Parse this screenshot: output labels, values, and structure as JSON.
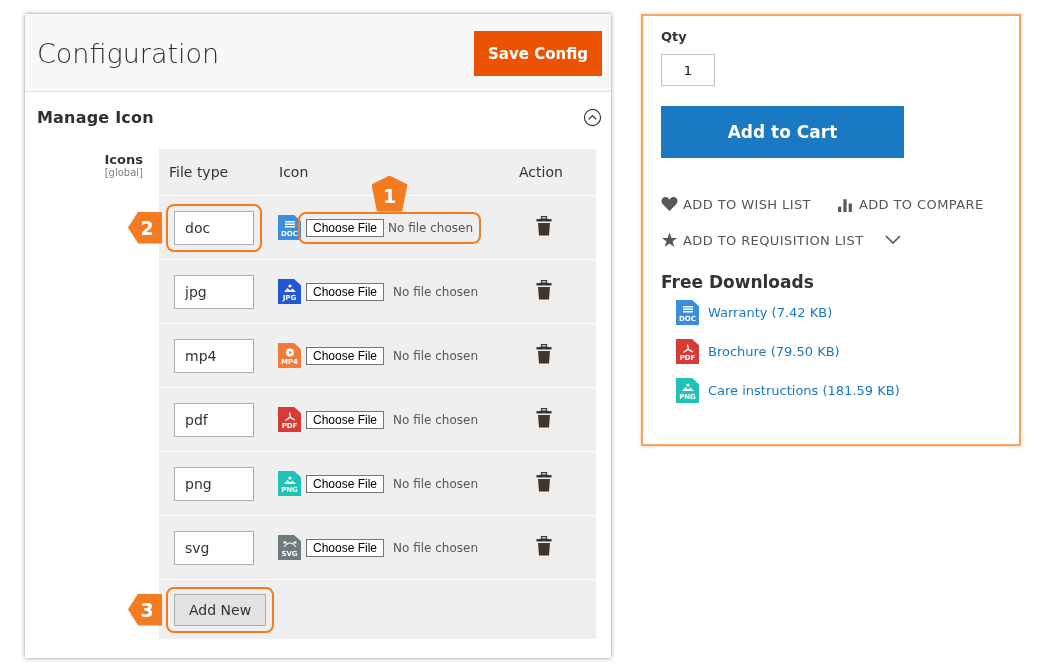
{
  "config": {
    "title": "Configuration",
    "save_button": "Save Config",
    "section": {
      "title": "Manage Icon",
      "expanded": true
    },
    "field_label": "Icons",
    "field_scope": "[global]",
    "columns": [
      "File type",
      "Icon",
      "Action"
    ],
    "rows": [
      {
        "file_type": "doc",
        "icon": {
          "kind": "doc",
          "label": "DOC",
          "color": "#3b8de0"
        },
        "choose": "Choose File",
        "status": "No file chosen",
        "type_callout": "2",
        "file_callout": "1"
      },
      {
        "file_type": "jpg",
        "icon": {
          "kind": "image",
          "label": "JPG",
          "color": "#2357d6"
        },
        "choose": "Choose File",
        "status": "No file chosen"
      },
      {
        "file_type": "mp4",
        "icon": {
          "kind": "play",
          "label": "MP4",
          "color": "#f47a3c"
        },
        "choose": "Choose File",
        "status": "No file chosen"
      },
      {
        "file_type": "pdf",
        "icon": {
          "kind": "pdf",
          "label": "PDF",
          "color": "#d83b35"
        },
        "choose": "Choose File",
        "status": "No file chosen"
      },
      {
        "file_type": "png",
        "icon": {
          "kind": "image",
          "label": "PNG",
          "color": "#1fc2b4"
        },
        "choose": "Choose File",
        "status": "No file chosen"
      },
      {
        "file_type": "svg",
        "icon": {
          "kind": "bezier",
          "label": "SVG",
          "color": "#6e7a7d"
        },
        "choose": "Choose File",
        "status": "No file chosen"
      }
    ],
    "add_button": "Add New",
    "add_callout": "3"
  },
  "product": {
    "qty_label": "Qty",
    "qty": "1",
    "add_to_cart": "Add to Cart",
    "actions": [
      {
        "kind": "heart",
        "label": "ADD TO WISH LIST"
      },
      {
        "kind": "chart",
        "label": "ADD TO COMPARE"
      },
      {
        "kind": "star",
        "label": "ADD TO REQUISITION LIST",
        "dropdown": true
      }
    ],
    "downloads_title": "Free Downloads",
    "downloads": [
      {
        "label": "Warranty (7.42 KB)",
        "icon": {
          "kind": "doc",
          "label": "DOC",
          "color": "#3b8de0"
        }
      },
      {
        "label": "Brochure (79.50 KB)",
        "icon": {
          "kind": "pdf",
          "label": "PDF",
          "color": "#d83b35"
        }
      },
      {
        "label": "Care instructions (181.59 KB)",
        "icon": {
          "kind": "image",
          "label": "PNG",
          "color": "#1fc2b4"
        }
      }
    ]
  }
}
